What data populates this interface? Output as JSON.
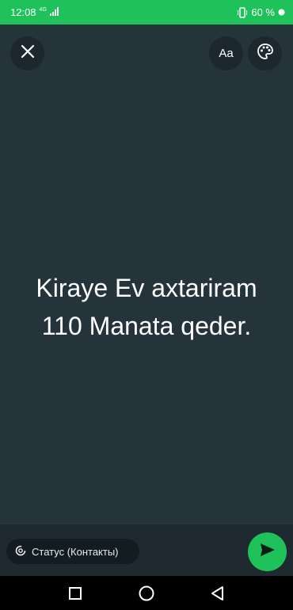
{
  "status_bar": {
    "time": "12:08",
    "network": "4G",
    "battery": "60 %"
  },
  "toolbar": {
    "font_label": "Aa"
  },
  "message": {
    "lines": [
      "Kiraye Ev axtariram",
      "110 Manata qeder."
    ]
  },
  "footer": {
    "audience_label": "Статус (Контакты)"
  },
  "colors": {
    "accent": "#1fc15a",
    "background": "#25343b"
  },
  "icons": [
    "close-icon",
    "palette-icon",
    "send-icon",
    "status-icon",
    "signal-icon",
    "battery-icon",
    "vibrate-icon"
  ]
}
